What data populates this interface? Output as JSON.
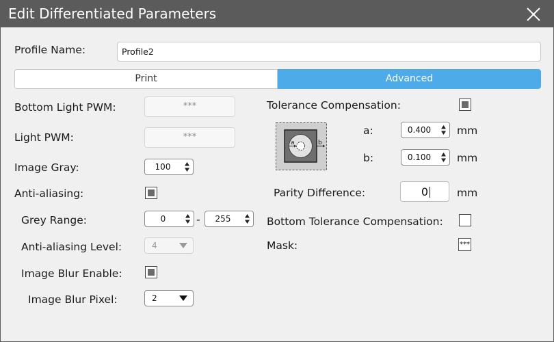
{
  "window": {
    "title": "Edit Differentiated Parameters"
  },
  "profile": {
    "label": "Profile Name:",
    "value": "Profile2"
  },
  "tabs": [
    {
      "label": "Print",
      "active": false
    },
    {
      "label": "Advanced",
      "active": true
    }
  ],
  "colors": {
    "titlebar": "#5b5b5b",
    "active_tab": "#4eabea",
    "background": "#f0f0f0"
  },
  "left": {
    "bottom_light_pwm": {
      "label": "Bottom Light PWM:",
      "value": "***"
    },
    "light_pwm": {
      "label": "Light PWM:",
      "value": "***"
    },
    "image_gray": {
      "label": "Image Gray:",
      "value": "100"
    },
    "anti_aliasing": {
      "label": "Anti-aliasing:",
      "checked": true
    },
    "grey_range": {
      "label": "Grey Range:",
      "min": "0",
      "separator": "-",
      "max": "255"
    },
    "aa_level": {
      "label": "Anti-aliasing Level:",
      "value": "4"
    },
    "blur_enable": {
      "label": "Image Blur Enable:",
      "checked": true
    },
    "blur_pixel": {
      "label": "Image Blur Pixel:",
      "value": "2"
    }
  },
  "right": {
    "tolerance": {
      "label": "Tolerance Compensation:",
      "checked": true
    },
    "diagram": {
      "a": "a",
      "b": "b"
    },
    "a": {
      "label": "a:",
      "value": "0.400",
      "unit": "mm"
    },
    "b": {
      "label": "b:",
      "value": "0.100",
      "unit": "mm"
    },
    "parity": {
      "label": "Parity Difference:",
      "value": "0",
      "unit": "mm"
    },
    "bottom_tolerance": {
      "label": "Bottom Tolerance Compensation:",
      "checked": false
    },
    "mask": {
      "label": "Mask:",
      "value": "***"
    }
  }
}
